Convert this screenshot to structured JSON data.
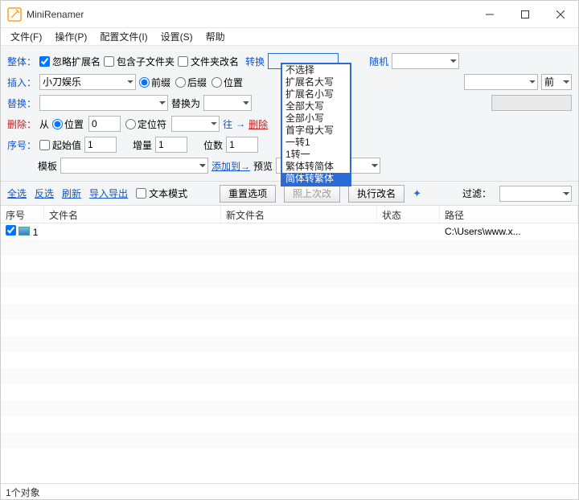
{
  "title": "MiniRenamer",
  "menu": [
    "文件(F)",
    "操作(P)",
    "配置文件(I)",
    "设置(S)",
    "帮助"
  ],
  "labels": {
    "zhengti": "整体：",
    "charu": "插入：",
    "tihuan": "替换：",
    "shanchu": "删除：",
    "xuhao": "序号：",
    "muban": "模板",
    "hulue": "忽略扩展名",
    "baohan": "包含子文件夹",
    "wenjianjia": "文件夹改名",
    "zhuanhuan": "转换",
    "suiji": "随机",
    "qianzhui": "前缀",
    "houzhui": "后缀",
    "weizhi_r": "位置",
    "qian": "前",
    "tihuanwei": "替换为",
    "cong": "从",
    "weizhi": "位置",
    "dingweifu": "定位符",
    "wang": "往",
    "shanchu_link": "删除",
    "qishizhi": "起始值",
    "zengliang": "增量",
    "weishu": "位数",
    "tianjiadao": "添加到→",
    "yulan": "预览",
    "quanxuan": "全选",
    "fanxuan": "反选",
    "shuaxin": "刷新",
    "daorudaochu": "导入导出",
    "wenbenmoshi": "文本模式",
    "chongzhi": "重置选项",
    "zhaoshang": "照上次改",
    "zhixing": "执行改名",
    "guolv": "过滤："
  },
  "insert_value": "小刀娱乐",
  "dropdown": [
    "不选择",
    "扩展名大写",
    "扩展名小写",
    "全部大写",
    "全部小写",
    "首字母大写",
    "一转1",
    "1转一",
    "繁体转简体",
    "简体转繁体"
  ],
  "spin": {
    "pos": "0",
    "start": "1",
    "inc": "1",
    "digits": "1"
  },
  "cols": {
    "idx": "序号",
    "fn": "文件名",
    "nf": "新文件名",
    "st": "状态",
    "pt": "路径"
  },
  "row1": {
    "num": "1",
    "path": "C:\\Users\\www.x..."
  },
  "status": "1个对象"
}
